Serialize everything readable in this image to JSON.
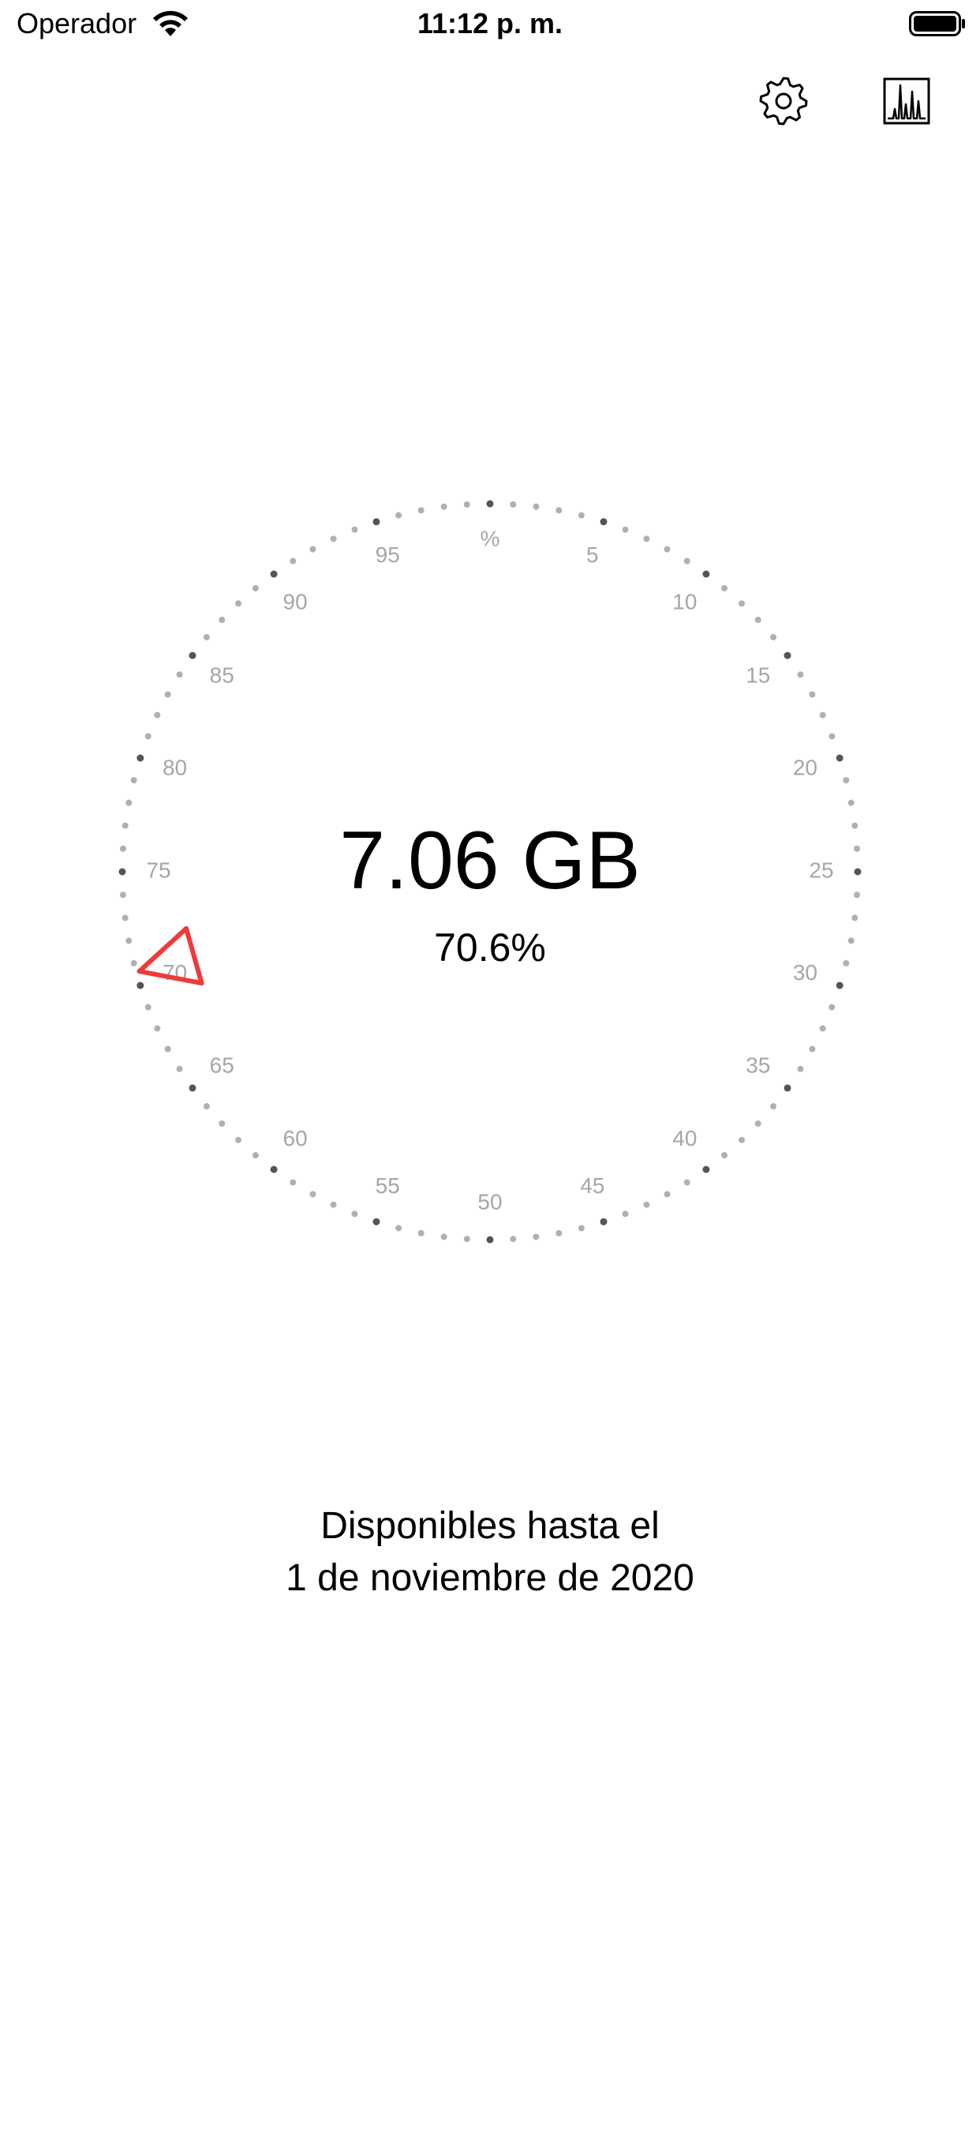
{
  "status_bar": {
    "carrier": "Operador",
    "time": "11:12 p. m.",
    "icons": [
      "wifi-icon",
      "battery-icon"
    ]
  },
  "toolbar": {
    "settings_icon": "gear-icon",
    "stats_icon": "bar-chart-icon"
  },
  "dial": {
    "unit_label": "%",
    "tick_labels": [
      "5",
      "10",
      "15",
      "20",
      "25",
      "30",
      "35",
      "40",
      "45",
      "50",
      "55",
      "60",
      "65",
      "70",
      "75",
      "80",
      "85",
      "90",
      "95"
    ],
    "level_percent": 70.6,
    "indicator_color": "#f03a3a",
    "major_dot_color": "#555555",
    "minor_dot_color": "#b0b0b0",
    "label_color": "#a6a6a6"
  },
  "usage": {
    "amount": "7.06 GB",
    "percent": "70.6%"
  },
  "availability": {
    "line1": "Disponibles hasta el",
    "line2": "1 de noviembre de 2020"
  }
}
